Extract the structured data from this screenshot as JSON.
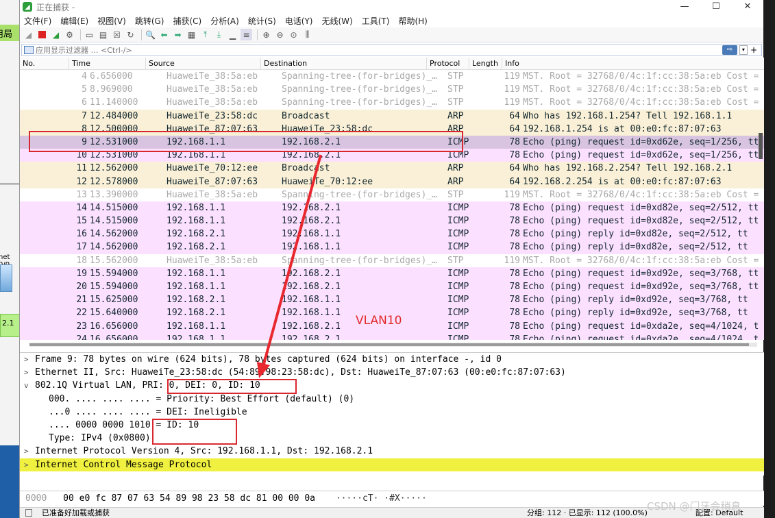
{
  "window": {
    "title": "正在捕获 -",
    "controls": [
      "—",
      "☐",
      "✕"
    ]
  },
  "menu": [
    "文件(F)",
    "编辑(E)",
    "视图(V)",
    "跳转(G)",
    "捕获(C)",
    "分析(A)",
    "统计(S)",
    "电话(Y)",
    "无线(W)",
    "工具(T)",
    "帮助(H)"
  ],
  "filter": {
    "placeholder": "应用显示过滤器 … <Ctrl-/>"
  },
  "columns": [
    "No.",
    "Time",
    "Source",
    "Destination",
    "Protocol",
    "Length",
    "Info"
  ],
  "packets": [
    {
      "no": "4",
      "time": "6.656000",
      "src": "HuaweiTe_38:5a:eb",
      "dst": "Spanning-tree-(for-bridges)_…",
      "proto": "STP",
      "len": "119",
      "info": "MST. Root = 32768/0/4c:1f:cc:38:5a:eb  Cost =",
      "kind": "stp"
    },
    {
      "no": "5",
      "time": "8.969000",
      "src": "HuaweiTe_38:5a:eb",
      "dst": "Spanning-tree-(for-bridges)_…",
      "proto": "STP",
      "len": "119",
      "info": "MST. Root = 32768/0/4c:1f:cc:38:5a:eb  Cost =",
      "kind": "stp"
    },
    {
      "no": "6",
      "time": "11.140000",
      "src": "HuaweiTe_38:5a:eb",
      "dst": "Spanning-tree-(for-bridges)_…",
      "proto": "STP",
      "len": "119",
      "info": "MST. Root = 32768/0/4c:1f:cc:38:5a:eb  Cost =",
      "kind": "stp"
    },
    {
      "no": "7",
      "time": "12.484000",
      "src": "HuaweiTe_23:58:dc",
      "dst": "Broadcast",
      "proto": "ARP",
      "len": "64",
      "info": "Who has 192.168.1.254? Tell 192.168.1.1",
      "kind": "arp"
    },
    {
      "no": "8",
      "time": "12.500000",
      "src": "HuaweiTe_87:07:63",
      "dst": "HuaweiTe_23:58:dc",
      "proto": "ARP",
      "len": "64",
      "info": "192.168.1.254 is at 00:e0:fc:87:07:63",
      "kind": "arp"
    },
    {
      "no": "9",
      "time": "12.531000",
      "src": "192.168.1.1",
      "dst": "192.168.2.1",
      "proto": "ICMP",
      "len": "78",
      "info": "Echo (ping) request  id=0xd62e, seq=1/256, tt",
      "kind": "sel"
    },
    {
      "no": "10",
      "time": "12.531000",
      "src": "192.168.1.1",
      "dst": "192.168.2.1",
      "proto": "ICMP",
      "len": "78",
      "info": "Echo (ping) request  id=0xd62e, seq=1/256, tt",
      "kind": "icmp"
    },
    {
      "no": "11",
      "time": "12.562000",
      "src": "HuaweiTe_70:12:ee",
      "dst": "Broadcast",
      "proto": "ARP",
      "len": "64",
      "info": "Who has 192.168.2.254? Tell 192.168.2.1",
      "kind": "arp"
    },
    {
      "no": "12",
      "time": "12.578000",
      "src": "HuaweiTe_87:07:63",
      "dst": "HuaweiTe_70:12:ee",
      "proto": "ARP",
      "len": "64",
      "info": "192.168.2.254 is at 00:e0:fc:87:07:63",
      "kind": "arp"
    },
    {
      "no": "13",
      "time": "13.390000",
      "src": "HuaweiTe_38:5a:eb",
      "dst": "Spanning-tree-(for-bridges)_…",
      "proto": "STP",
      "len": "119",
      "info": "MST. Root = 32768/0/4c:1f:cc:38:5a:eb  Cost =",
      "kind": "stp"
    },
    {
      "no": "14",
      "time": "14.515000",
      "src": "192.168.1.1",
      "dst": "192.168.2.1",
      "proto": "ICMP",
      "len": "78",
      "info": "Echo (ping) request  id=0xd82e, seq=2/512, tt",
      "kind": "icmp"
    },
    {
      "no": "15",
      "time": "14.515000",
      "src": "192.168.1.1",
      "dst": "192.168.2.1",
      "proto": "ICMP",
      "len": "78",
      "info": "Echo (ping) request  id=0xd82e, seq=2/512, tt",
      "kind": "icmp"
    },
    {
      "no": "16",
      "time": "14.562000",
      "src": "192.168.2.1",
      "dst": "192.168.1.1",
      "proto": "ICMP",
      "len": "78",
      "info": "Echo (ping) reply    id=0xd82e, seq=2/512, tt",
      "kind": "icmp"
    },
    {
      "no": "17",
      "time": "14.562000",
      "src": "192.168.2.1",
      "dst": "192.168.1.1",
      "proto": "ICMP",
      "len": "78",
      "info": "Echo (ping) reply    id=0xd82e, seq=2/512, tt",
      "kind": "icmp"
    },
    {
      "no": "18",
      "time": "15.562000",
      "src": "HuaweiTe_38:5a:eb",
      "dst": "Spanning-tree-(for-bridges)_…",
      "proto": "STP",
      "len": "119",
      "info": "MST. Root = 32768/0/4c:1f:cc:38:5a:eb  Cost =",
      "kind": "stp"
    },
    {
      "no": "19",
      "time": "15.594000",
      "src": "192.168.1.1",
      "dst": "192.168.2.1",
      "proto": "ICMP",
      "len": "78",
      "info": "Echo (ping) request  id=0xd92e, seq=3/768, tt",
      "kind": "icmp"
    },
    {
      "no": "20",
      "time": "15.594000",
      "src": "192.168.1.1",
      "dst": "192.168.2.1",
      "proto": "ICMP",
      "len": "78",
      "info": "Echo (ping) request  id=0xd92e, seq=3/768, tt",
      "kind": "icmp"
    },
    {
      "no": "21",
      "time": "15.625000",
      "src": "192.168.2.1",
      "dst": "192.168.1.1",
      "proto": "ICMP",
      "len": "78",
      "info": "Echo (ping) reply    id=0xd92e, seq=3/768, tt",
      "kind": "icmp"
    },
    {
      "no": "22",
      "time": "15.640000",
      "src": "192.168.2.1",
      "dst": "192.168.1.1",
      "proto": "ICMP",
      "len": "78",
      "info": "Echo (ping) reply    id=0xd92e, seq=3/768, tt",
      "kind": "icmp"
    },
    {
      "no": "23",
      "time": "16.656000",
      "src": "192.168.1.1",
      "dst": "192.168.2.1",
      "proto": "ICMP",
      "len": "78",
      "info": "Echo (ping) request  id=0xda2e, seq=4/1024, t",
      "kind": "icmp"
    },
    {
      "no": "24",
      "time": "16.656000",
      "src": "192.168.1.1",
      "dst": "192.168.2.1",
      "proto": "ICMP",
      "len": "78",
      "info": "Echo (ping) request  id=0xda2e, seq=4/1024, t",
      "kind": "icmp"
    }
  ],
  "details": [
    {
      "twisty": ">",
      "text": "Frame 9: 78 bytes on wire (624 bits), 78 bytes captured (624 bits) on interface -, id 0",
      "indent": false,
      "hl": false
    },
    {
      "twisty": ">",
      "text": "Ethernet II, Src: HuaweiTe_23:58:dc (54:89:98:23:58:dc), Dst: HuaweiTe_87:07:63 (00:e0:fc:87:07:63)",
      "indent": false,
      "hl": false
    },
    {
      "twisty": "v",
      "text": "802.1Q Virtual LAN, PRI: 0, DEI: 0, ID: 10",
      "indent": false,
      "hl": false
    },
    {
      "twisty": "",
      "text": "000. .... .... .... = Priority: Best Effort (default) (0)",
      "indent": true,
      "hl": false
    },
    {
      "twisty": "",
      "text": "...0 .... .... .... = DEI: Ineligible",
      "indent": true,
      "hl": false
    },
    {
      "twisty": "",
      "text": ".... 0000 0000 1010 = ID: 10",
      "indent": true,
      "hl": false
    },
    {
      "twisty": "",
      "text": "Type: IPv4 (0x0800)",
      "indent": true,
      "hl": false
    },
    {
      "twisty": ">",
      "text": "Internet Protocol Version 4, Src: 192.168.1.1, Dst: 192.168.2.1",
      "indent": false,
      "hl": false
    },
    {
      "twisty": ">",
      "text": "Internet Control Message Protocol",
      "indent": false,
      "hl": true
    }
  ],
  "bytes": {
    "offset": "0000",
    "hex": "00 e0 fc 87 07 63 54 89  98 23 58 dc 81 00 00 0a",
    "ascii": "·····cT· ·#X·····"
  },
  "status": {
    "ready": "已准备好加载或捕获",
    "stats": "分组: 112 · 已显示: 112 (100.0%)",
    "profile": "配置: Default"
  },
  "annotations": {
    "vlan_label": "VLAN10",
    "watermark": "CSDN @门牙会稍息"
  },
  "background": {
    "left_label_1": "用局",
    "left_label_2": "net 0/0",
    "left_label_3": "2.1"
  },
  "colors": {
    "stp_bg": "#ffffff",
    "arp_bg": "#faf0d7",
    "icmp_bg": "#fce0ff",
    "selected_bg": "#d8c4e0",
    "highlight_yellow": "#f0f040",
    "annotation_red": "#d9272e"
  }
}
